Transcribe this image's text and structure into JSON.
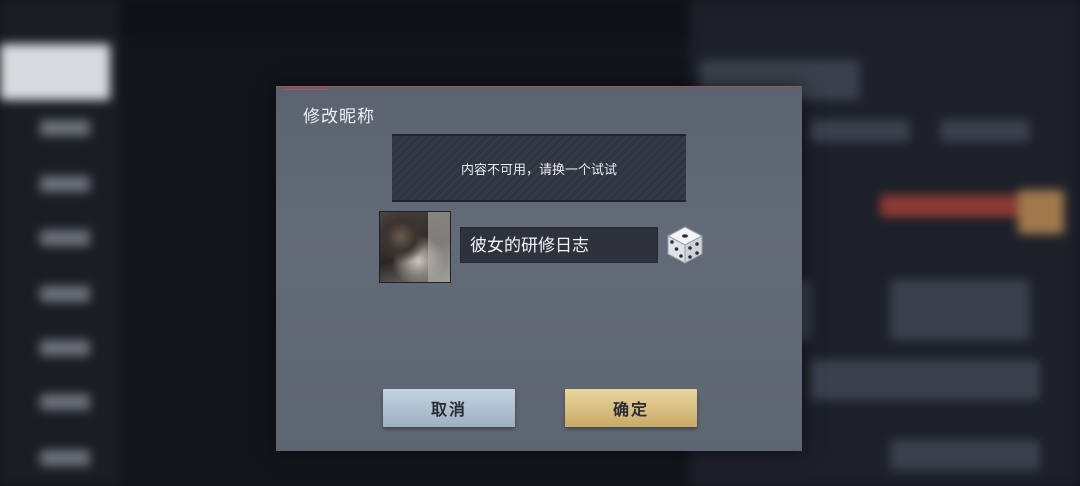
{
  "dialog": {
    "title": "修改昵称",
    "notice": "内容不可用，请换一个试试",
    "nickname": "彼女的研修日志",
    "cancel_label": "取消",
    "confirm_label": "确定"
  },
  "colors": {
    "dialog_bg": "#5f6673",
    "notice_bg": "#2f3540",
    "input_bg": "#2d323c",
    "cancel_btn": "#b3c3d4",
    "confirm_btn": "#dcc383",
    "title_accent": "#b44a44"
  },
  "icons": {
    "random": "dice-icon",
    "avatar": "avatar-image"
  }
}
